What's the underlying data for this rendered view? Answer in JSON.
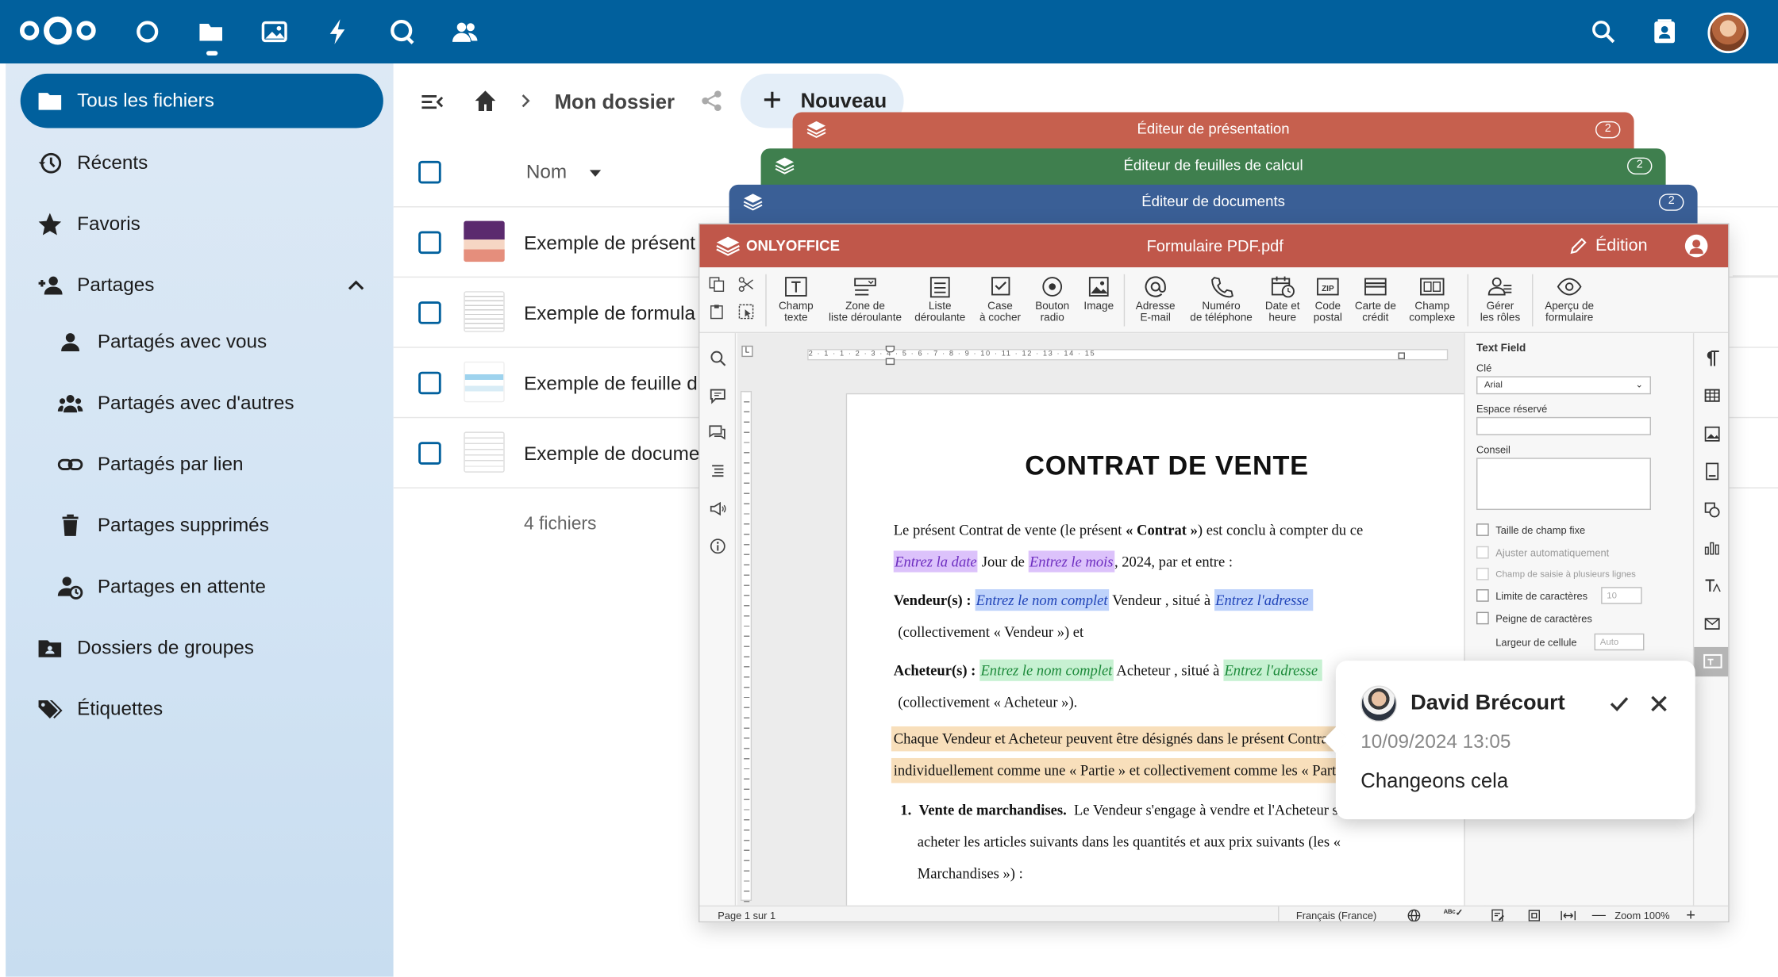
{
  "topbar": {
    "apps": [
      "dashboard-icon",
      "files-icon",
      "photos-icon",
      "activity-icon",
      "talk-icon",
      "contacts-icon"
    ],
    "right": [
      "search-icon",
      "contacts-menu-icon",
      "user-avatar"
    ]
  },
  "sidebar": {
    "items": [
      {
        "label": "Tous les fichiers",
        "icon": "folder-icon",
        "active": true
      },
      {
        "label": "Récents",
        "icon": "history-icon"
      },
      {
        "label": "Favoris",
        "icon": "star-icon"
      },
      {
        "label": "Partages",
        "icon": "share-icon",
        "expanded": true
      },
      {
        "label": "Partagés avec vous",
        "icon": "person-icon"
      },
      {
        "label": "Partagés avec d'autres",
        "icon": "people-icon"
      },
      {
        "label": "Partagés par lien",
        "icon": "link-icon"
      },
      {
        "label": "Partages supprimés",
        "icon": "trash-icon"
      },
      {
        "label": "Partages en attente",
        "icon": "pending-icon"
      },
      {
        "label": "Dossiers de groupes",
        "icon": "group-folder-icon"
      },
      {
        "label": "Étiquettes",
        "icon": "tags-icon"
      }
    ]
  },
  "files": {
    "breadcrumb": "Mon dossier",
    "new_button": "Nouveau",
    "column_name": "Nom",
    "rows": [
      "Exemple de présent",
      "Exemple de formula",
      "Exemple de feuille d",
      "Exemple de docume"
    ],
    "count": "4 fichiers"
  },
  "layers": [
    {
      "title": "Éditeur de présentation",
      "badge": "2",
      "color": "#c6604e"
    },
    {
      "title": "Éditeur de feuilles de calcul",
      "badge": "2",
      "color": "#3f7f4e"
    },
    {
      "title": "Éditeur de documents",
      "badge": "2",
      "color": "#3a5f96"
    }
  ],
  "editor": {
    "brand": "ONLYOFFICE",
    "filename": "Formulaire PDF.pdf",
    "mode": "Édition",
    "header_color": "#c0574a",
    "toolbar": [
      [
        "Champ",
        "texte"
      ],
      [
        "Zone de",
        "liste déroulante"
      ],
      [
        "Liste",
        "déroulante"
      ],
      [
        "Case",
        "à cocher"
      ],
      [
        "Bouton",
        "radio"
      ],
      [
        "Image",
        ""
      ],
      [
        "Adresse",
        "E-mail"
      ],
      [
        "Numéro",
        "de téléphone"
      ],
      [
        "Date et",
        "heure"
      ],
      [
        "Code",
        "postal"
      ],
      [
        "Carte de",
        "crédit"
      ],
      [
        "Champ",
        "complexe"
      ],
      [
        "Gérer",
        "les rôles"
      ],
      [
        "Aperçu de",
        "formulaire"
      ]
    ],
    "ruler_numbers": "2 · 1 · 1 · 2 · 3 · 4 · 5 · 6 · 7 · 8 · 9 · 10 · 11 · 12 · 13 · 14 · 15",
    "doc": {
      "title": "CONTRAT DE VENTE",
      "p1": "Le présent Contrat de vente (le présent « Contrat ») est conclu à compter du ce",
      "p1_pre": "Le présent Contrat de vente (le présent ",
      "p1_bold": "« Contrat »",
      "p1_post": ") est conclu à compter du ce",
      "date_field": "Entrez la date",
      "jour_de": "Jour de",
      "month_field": "Entrez le mois",
      "year_text": ", 2024,  par et entre :",
      "vendeur_label": "Vendeur(s) :",
      "name_field": "Entrez le nom complet",
      "vendeur_mid": "Vendeur , situé à",
      "address_field": "Entrez l'adresse",
      "vendeur_coll": "(collectivement « Vendeur ») et",
      "acheteur_label": "Acheteur(s) :",
      "acheteur_mid": "Acheteur , situé à",
      "acheteur_coll": "(collectivement « Acheteur »).",
      "hl1": "Chaque Vendeur et Acheteur peuvent être désignés dans le présent Contra",
      "hl2": "individuellement comme une « Partie » et collectivement comme les « Parti",
      "item_num": "1.",
      "item_title": "Vente de marchandises.",
      "item_text1": "Le Vendeur s'engage à vendre et l'Acheteur s'",
      "item_text2": "acheter les articles suivants dans les quantités et aux prix suivants (les «",
      "item_text3": "Marchandises ») :"
    },
    "panel": {
      "title": "Text Field",
      "key_label": "Clé",
      "key_value": "Arial",
      "placeholder_label": "Espace réservé",
      "tip_label": "Conseil",
      "fixed_size": "Taille de champ fixe",
      "autofit": "Ajuster automatiquement",
      "multiline": "Champ de saisie à plusieurs lignes",
      "char_limit": "Limite de caractères",
      "char_limit_value": "10",
      "comb": "Peigne de caractères",
      "cell_width": "Largeur de cellule",
      "cell_width_value": "Auto"
    },
    "status": {
      "page": "Page 1 sur 1",
      "language": "Français  (France)",
      "zoom": "Zoom 100%"
    }
  },
  "comment": {
    "author": "David Brécourt",
    "date": "10/09/2024 13:05",
    "text": "Changeons cela"
  }
}
